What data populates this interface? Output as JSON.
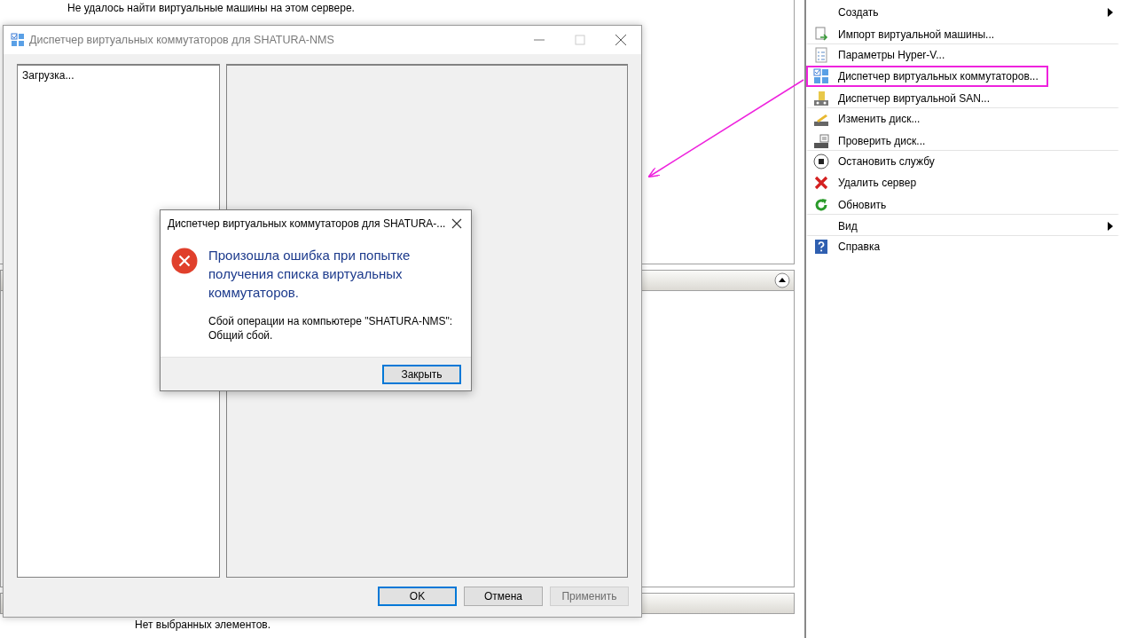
{
  "console": {
    "message": "Не удалось найти виртуальные машины на этом сервере.",
    "footer_message": "Нет выбранных элементов."
  },
  "actions": [
    {
      "label": "Создать",
      "kind": "plain",
      "submenu": true,
      "highlighted": false,
      "divider": false
    },
    {
      "label": "Импорт виртуальной машины...",
      "kind": "import",
      "submenu": false,
      "highlighted": false,
      "divider": true
    },
    {
      "label": "Параметры Hyper-V...",
      "kind": "settings",
      "submenu": false,
      "highlighted": false,
      "divider": false
    },
    {
      "label": "Диспетчер виртуальных коммутаторов...",
      "kind": "switch",
      "submenu": false,
      "highlighted": true,
      "divider": false
    },
    {
      "label": "Диспетчер виртуальной SAN...",
      "kind": "san",
      "submenu": false,
      "highlighted": false,
      "divider": true
    },
    {
      "label": "Изменить диск...",
      "kind": "edit-disk",
      "submenu": false,
      "highlighted": false,
      "divider": false
    },
    {
      "label": "Проверить диск...",
      "kind": "inspect-disk",
      "submenu": false,
      "highlighted": false,
      "divider": true
    },
    {
      "label": "Остановить службу",
      "kind": "stop",
      "submenu": false,
      "highlighted": false,
      "divider": false
    },
    {
      "label": "Удалить сервер",
      "kind": "delete",
      "submenu": false,
      "highlighted": false,
      "divider": false
    },
    {
      "label": "Обновить",
      "kind": "refresh",
      "submenu": false,
      "highlighted": false,
      "divider": true
    },
    {
      "label": "Вид",
      "kind": "plain",
      "submenu": true,
      "highlighted": false,
      "divider": true
    },
    {
      "label": "Справка",
      "kind": "help",
      "submenu": false,
      "highlighted": false,
      "divider": false
    }
  ],
  "switch_manager": {
    "title": "Диспетчер виртуальных коммутаторов для SHATURA-NMS",
    "list_status": "Загрузка...",
    "buttons": [
      {
        "label": "OK",
        "default": true,
        "disabled": false
      },
      {
        "label": "Отмена",
        "default": false,
        "disabled": false
      },
      {
        "label": "Применить",
        "default": false,
        "disabled": true
      }
    ]
  },
  "error_dialog": {
    "title": "Диспетчер виртуальных коммутаторов для SHATURA-...",
    "heading": "Произошла ошибка при попытке получения списка виртуальных коммутаторов.",
    "detail": "Сбой операции на компьютере \"SHATURA-NMS\":\nОбщий сбой.",
    "buttons": [
      {
        "label": "Закрыть",
        "default": true,
        "disabled": false
      }
    ]
  }
}
